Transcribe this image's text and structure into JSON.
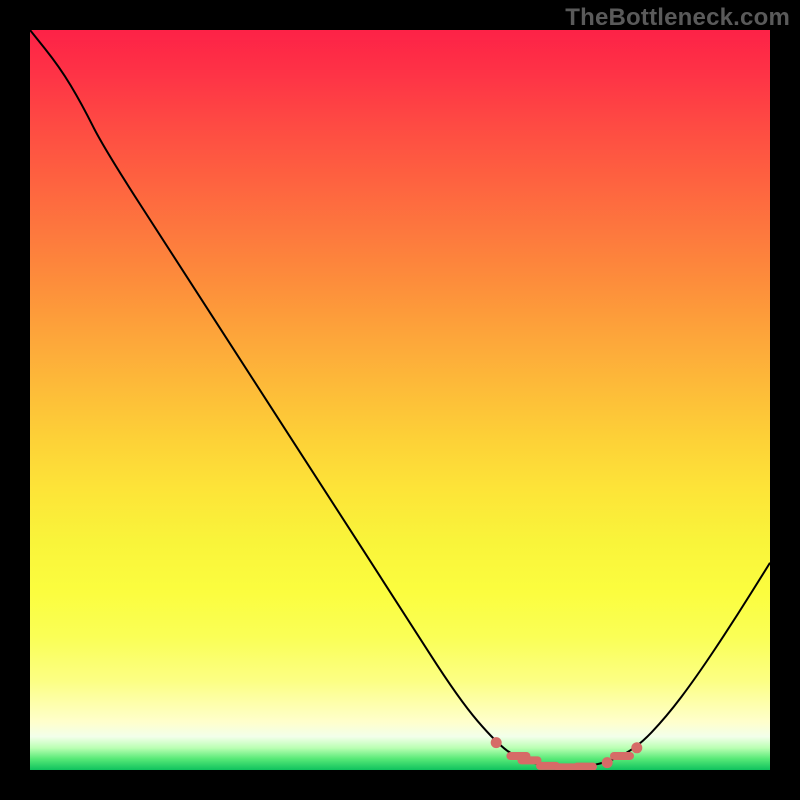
{
  "watermark": "TheBottleneck.com",
  "chart_data": {
    "type": "line",
    "title": "",
    "xlabel": "",
    "ylabel": "",
    "xlim": [
      0,
      100
    ],
    "ylim": [
      0,
      100
    ],
    "curve": [
      {
        "x": 0,
        "y": 100
      },
      {
        "x": 4,
        "y": 95
      },
      {
        "x": 7,
        "y": 90
      },
      {
        "x": 10,
        "y": 84
      },
      {
        "x": 20,
        "y": 68.5
      },
      {
        "x": 30,
        "y": 53
      },
      {
        "x": 40,
        "y": 37.5
      },
      {
        "x": 50,
        "y": 22
      },
      {
        "x": 58,
        "y": 9.5
      },
      {
        "x": 63,
        "y": 3.7
      },
      {
        "x": 66,
        "y": 1.5
      },
      {
        "x": 70,
        "y": 0.4
      },
      {
        "x": 74,
        "y": 0.3
      },
      {
        "x": 78,
        "y": 1.0
      },
      {
        "x": 82,
        "y": 3.0
      },
      {
        "x": 86,
        "y": 7.2
      },
      {
        "x": 90,
        "y": 12.5
      },
      {
        "x": 95,
        "y": 20
      },
      {
        "x": 100,
        "y": 28
      }
    ],
    "optimal_markers": [
      {
        "x": 63,
        "y": 3.7,
        "kind": "dot"
      },
      {
        "x": 66,
        "y": 1.9,
        "kind": "dash"
      },
      {
        "x": 67.5,
        "y": 1.3,
        "kind": "dash"
      },
      {
        "x": 70,
        "y": 0.55,
        "kind": "dash"
      },
      {
        "x": 72.5,
        "y": 0.35,
        "kind": "dash"
      },
      {
        "x": 75,
        "y": 0.45,
        "kind": "dash"
      },
      {
        "x": 78,
        "y": 1.0,
        "kind": "dot"
      },
      {
        "x": 80,
        "y": 1.9,
        "kind": "dash"
      },
      {
        "x": 82,
        "y": 3.0,
        "kind": "dot"
      }
    ],
    "background_gradient": {
      "top_color": "#fd2247",
      "mid_color": "#fdd037",
      "bottom_color": "#0fc25e",
      "meaning": "red=high bottleneck, green=balanced"
    }
  }
}
